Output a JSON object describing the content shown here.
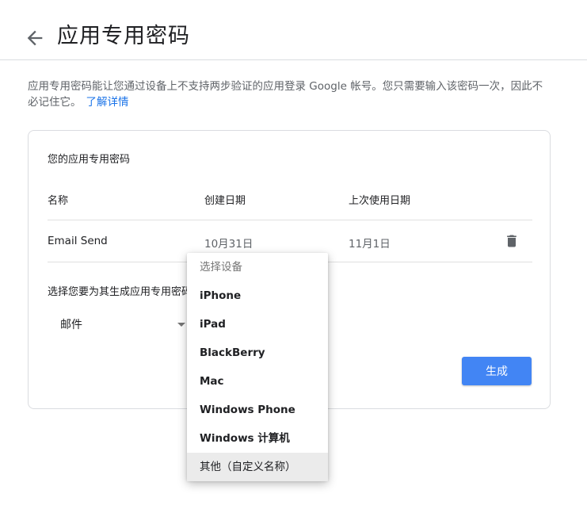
{
  "header": {
    "title": "应用专用密码",
    "back_icon": "arrow-left-icon"
  },
  "description": {
    "text": "应用专用密码能让您通过设备上不支持两步验证的应用登录 Google 帐号。您只需要输入该密码一次，因此不必记住它。",
    "learn_more": "了解详情"
  },
  "card": {
    "title": "您的应用专用密码",
    "columns": {
      "name": "名称",
      "created": "创建日期",
      "last_used": "上次使用日期"
    },
    "passwords": [
      {
        "name": "Email Send",
        "created": "10月31日",
        "last_used": "11月1日",
        "delete_icon": "trash-icon"
      }
    ],
    "select_label": "选择您要为其生成应用专用密码的应用和设备。",
    "app_select": {
      "value": "邮件"
    },
    "generate_button": "生成"
  },
  "device_dropdown": {
    "header": "选择设备",
    "options": [
      "iPhone",
      "iPad",
      "BlackBerry",
      "Mac",
      "Windows Phone",
      "Windows 计算机",
      "其他（自定义名称）"
    ],
    "highlighted_index": 6
  },
  "colors": {
    "accent": "#4285f4",
    "link": "#1a73e8",
    "divider": "#dadce0"
  }
}
